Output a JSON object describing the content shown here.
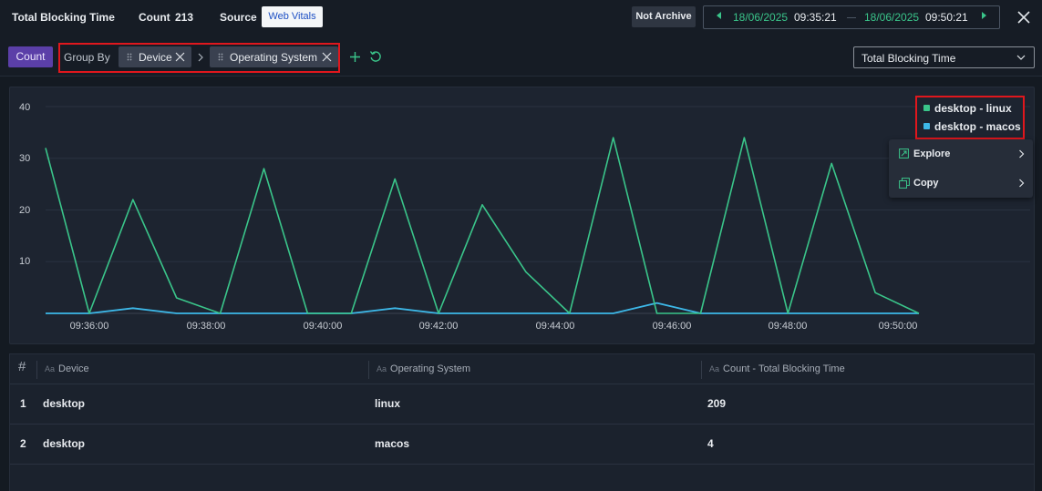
{
  "header": {
    "metric_title": "Total Blocking Time",
    "count_label": "Count",
    "count_value": "213",
    "source_label": "Source",
    "source_value": "Web Vitals",
    "archive_button": "Not Archive",
    "time_range": {
      "start_date": "18/06/2025",
      "start_time": "09:35:21",
      "end_date": "18/06/2025",
      "end_time": "09:50:21"
    },
    "close_icon": "close-icon"
  },
  "toolbar": {
    "count_button": "Count",
    "group_by_label": "Group By",
    "group_chips": [
      {
        "label": "Device"
      },
      {
        "label": "Operating System"
      }
    ],
    "add_icon": "plus-icon",
    "reset_icon": "refresh-icon",
    "metric_select": "Total Blocking Time"
  },
  "colors": {
    "linux": "#3ac58a",
    "macos": "#3db8e8",
    "accent": "#5b3fa8",
    "highlight": "#e0171d"
  },
  "chart_data": {
    "type": "line",
    "y_ticks": [
      "10",
      "20",
      "30",
      "40"
    ],
    "ylim": [
      0,
      40
    ],
    "x_ticks": [
      "09:36:00",
      "09:38:00",
      "09:40:00",
      "09:42:00",
      "09:44:00",
      "09:46:00",
      "09:48:00",
      "09:50:00"
    ],
    "x": [
      "09:35:00",
      "09:35:45",
      "09:36:30",
      "09:37:15",
      "09:38:00",
      "09:38:45",
      "09:39:30",
      "09:40:15",
      "09:41:00",
      "09:41:45",
      "09:42:30",
      "09:43:15",
      "09:44:00",
      "09:44:45",
      "09:45:30",
      "09:46:15",
      "09:47:00",
      "09:47:45",
      "09:48:30",
      "09:49:15",
      "09:50:00"
    ],
    "series": [
      {
        "name": "desktop - linux",
        "values": [
          32,
          0,
          22,
          3,
          0,
          28,
          0,
          0,
          26,
          0,
          21,
          8,
          0,
          34,
          0,
          0,
          34,
          0,
          29,
          4,
          0
        ]
      },
      {
        "name": "desktop - macos",
        "values": [
          0,
          0,
          1,
          0,
          0,
          0,
          0,
          0,
          1,
          0,
          0,
          0,
          0,
          0,
          2,
          0,
          0,
          0,
          0,
          0,
          0
        ]
      }
    ],
    "grid": true,
    "legend_position": "top-right"
  },
  "context_menu": {
    "items": [
      {
        "label": "Explore",
        "icon": "explore-icon"
      },
      {
        "label": "Copy",
        "icon": "copy-icon"
      }
    ]
  },
  "table": {
    "index_header": "#",
    "columns": [
      "Device",
      "Operating System",
      "Count - Total Blocking Time"
    ],
    "type_badge": "Aa",
    "rows": [
      {
        "index": "1",
        "device": "desktop",
        "os": "linux",
        "count": "209"
      },
      {
        "index": "2",
        "device": "desktop",
        "os": "macos",
        "count": "4"
      }
    ]
  }
}
